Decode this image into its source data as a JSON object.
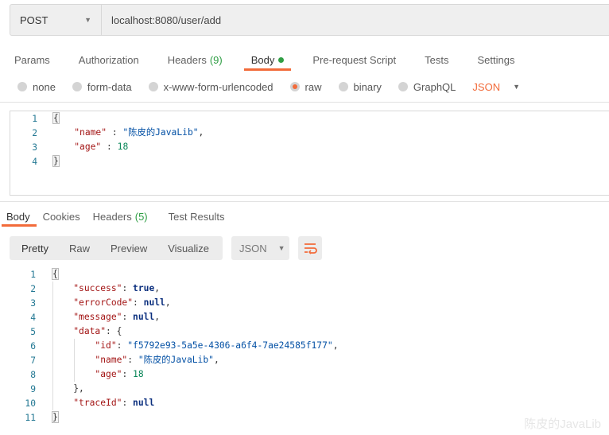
{
  "request": {
    "method": "POST",
    "url": "localhost:8080/user/add"
  },
  "request_tabs": [
    {
      "label": "Params"
    },
    {
      "label": "Authorization"
    },
    {
      "label": "Headers",
      "count": "(9)"
    },
    {
      "label": "Body",
      "active": true
    },
    {
      "label": "Pre-request Script"
    },
    {
      "label": "Tests"
    },
    {
      "label": "Settings"
    }
  ],
  "body_types": [
    {
      "label": "none"
    },
    {
      "label": "form-data"
    },
    {
      "label": "x-www-form-urlencoded"
    },
    {
      "label": "raw",
      "selected": true
    },
    {
      "label": "binary"
    },
    {
      "label": "GraphQL"
    }
  ],
  "body_format": "JSON",
  "request_body": [
    [
      [
        "p",
        "{"
      ]
    ],
    [
      [
        "p",
        "    "
      ],
      [
        "k",
        "\"name\""
      ],
      [
        "p",
        " : "
      ],
      [
        "s",
        "\"陈皮的JavaLib\""
      ],
      [
        "p",
        ","
      ]
    ],
    [
      [
        "p",
        "    "
      ],
      [
        "k",
        "\"age\""
      ],
      [
        "p",
        " : "
      ],
      [
        "n",
        "18"
      ]
    ],
    [
      [
        "p",
        "}"
      ]
    ]
  ],
  "response_tabs": [
    {
      "label": "Body",
      "active": true
    },
    {
      "label": "Cookies"
    },
    {
      "label": "Headers",
      "count": "(5)"
    },
    {
      "label": "Test Results"
    }
  ],
  "view_modes": [
    "Pretty",
    "Raw",
    "Preview",
    "Visualize"
  ],
  "response_format": "JSON",
  "response_body": [
    [
      [
        "p",
        "{"
      ]
    ],
    [
      [
        "p",
        "    "
      ],
      [
        "k",
        "\"success\""
      ],
      [
        "p",
        ": "
      ],
      [
        "b",
        "true"
      ],
      [
        "p",
        ","
      ]
    ],
    [
      [
        "p",
        "    "
      ],
      [
        "k",
        "\"errorCode\""
      ],
      [
        "p",
        ": "
      ],
      [
        "b",
        "null"
      ],
      [
        "p",
        ","
      ]
    ],
    [
      [
        "p",
        "    "
      ],
      [
        "k",
        "\"message\""
      ],
      [
        "p",
        ": "
      ],
      [
        "b",
        "null"
      ],
      [
        "p",
        ","
      ]
    ],
    [
      [
        "p",
        "    "
      ],
      [
        "k",
        "\"data\""
      ],
      [
        "p",
        ": {"
      ]
    ],
    [
      [
        "p",
        "        "
      ],
      [
        "k",
        "\"id\""
      ],
      [
        "p",
        ": "
      ],
      [
        "s",
        "\"f5792e93-5a5e-4306-a6f4-7ae24585f177\""
      ],
      [
        "p",
        ","
      ]
    ],
    [
      [
        "p",
        "        "
      ],
      [
        "k",
        "\"name\""
      ],
      [
        "p",
        ": "
      ],
      [
        "s",
        "\"陈皮的JavaLib\""
      ],
      [
        "p",
        ","
      ]
    ],
    [
      [
        "p",
        "        "
      ],
      [
        "k",
        "\"age\""
      ],
      [
        "p",
        ": "
      ],
      [
        "n",
        "18"
      ]
    ],
    [
      [
        "p",
        "    },"
      ]
    ],
    [
      [
        "p",
        "    "
      ],
      [
        "k",
        "\"traceId\""
      ],
      [
        "p",
        ": "
      ],
      [
        "b",
        "null"
      ]
    ],
    [
      [
        "p",
        "}"
      ]
    ]
  ],
  "watermark": "陈皮的JavaLib"
}
